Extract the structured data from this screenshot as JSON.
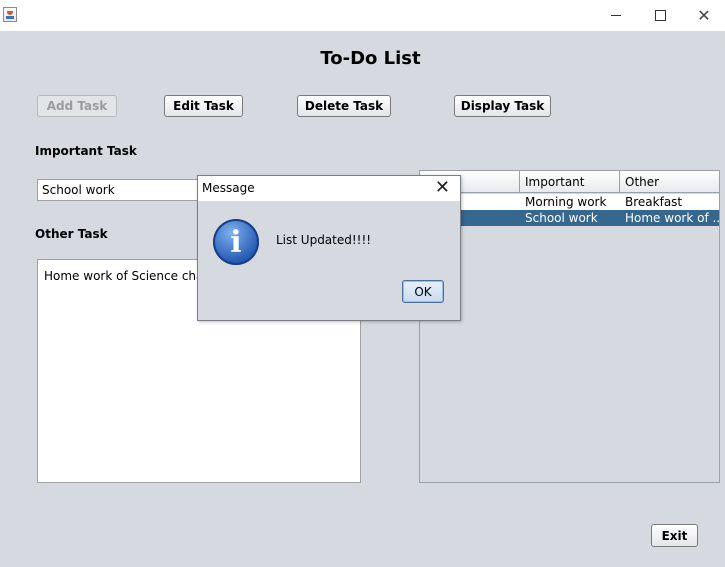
{
  "window": {
    "icon": "java-app-icon",
    "controls": {
      "minimize": "",
      "maximize": "",
      "close": "✕"
    }
  },
  "app": {
    "title": "To-Do List"
  },
  "toolbar": {
    "add_label": "Add Task",
    "edit_label": "Edit Task",
    "delete_label": "Delete Task",
    "display_label": "Display Task"
  },
  "form": {
    "important_label": "Important Task",
    "important_value": "School work",
    "other_label": "Other Task",
    "other_value": "Home work of Science chapter"
  },
  "table": {
    "columns": [
      "",
      "Important",
      "Other"
    ],
    "rows": [
      {
        "cells": [
          "",
          "Morning work",
          "Breakfast"
        ],
        "selected": false
      },
      {
        "cells": [
          "",
          "School work",
          "Home work of ..."
        ],
        "selected": true
      }
    ]
  },
  "dialog": {
    "title": "Message",
    "message": "List Updated!!!!",
    "ok_label": "OK",
    "icon": "information-icon",
    "close_glyph": "✕"
  },
  "footer": {
    "exit_label": "Exit"
  },
  "colors": {
    "background": "#d6d9e0",
    "selection": "#35678f",
    "info_icon": "#2a5fb7"
  }
}
